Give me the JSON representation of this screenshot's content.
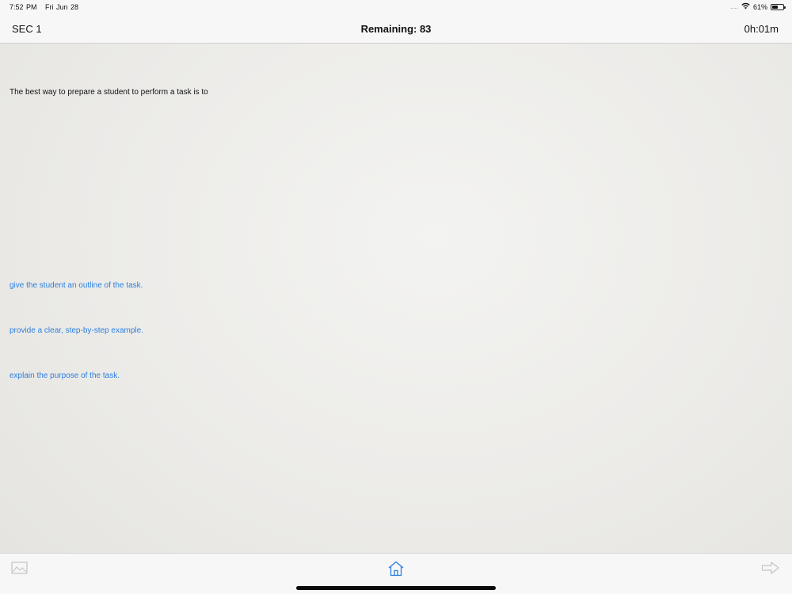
{
  "status_bar": {
    "time": "7:52 PM",
    "date": "Fri Jun 28",
    "signal": "....",
    "battery_text": "61%",
    "battery_level": 0.61
  },
  "nav": {
    "section": "SEC 1",
    "remaining": "Remaining: 83",
    "timer": "0h:01m"
  },
  "question": {
    "text": "The best way to prepare a student to perform a task is to"
  },
  "answers": [
    "give the student an outline of the task.",
    "provide a clear, step-by-step example.",
    "explain the purpose of the task."
  ],
  "toolbar": {
    "left_icon": "image-icon",
    "center_icon": "home-icon",
    "right_icon": "next-arrow-icon"
  },
  "colors": {
    "accent": "#2a7fe0",
    "text": "#111111",
    "bar_background": "#f7f7f7"
  }
}
